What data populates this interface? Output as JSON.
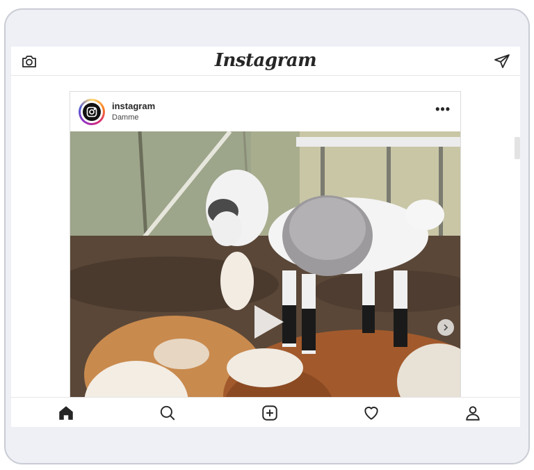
{
  "app": {
    "logo_text": "Instagram"
  },
  "topbar": {
    "camera_icon": "camera-icon",
    "direct_icon": "paper-plane-icon"
  },
  "post": {
    "username": "instagram",
    "location": "Damme",
    "more_label": "•••",
    "media": {
      "type": "video",
      "play_icon": "play-icon",
      "next_icon": "chevron-right-icon"
    }
  },
  "bottom_nav": {
    "items": [
      {
        "icon": "home-icon",
        "active": true
      },
      {
        "icon": "search-icon",
        "active": false
      },
      {
        "icon": "add-post-icon",
        "active": false
      },
      {
        "icon": "heart-icon",
        "active": false
      },
      {
        "icon": "profile-icon",
        "active": false
      }
    ]
  },
  "colors": {
    "text": "#262626",
    "border": "#dbdbdb",
    "device_bg": "#eef0f6",
    "avatar_gradient": [
      "#feda75",
      "#fa7e1e",
      "#d62976",
      "#962fbf",
      "#4f5bd5"
    ]
  }
}
